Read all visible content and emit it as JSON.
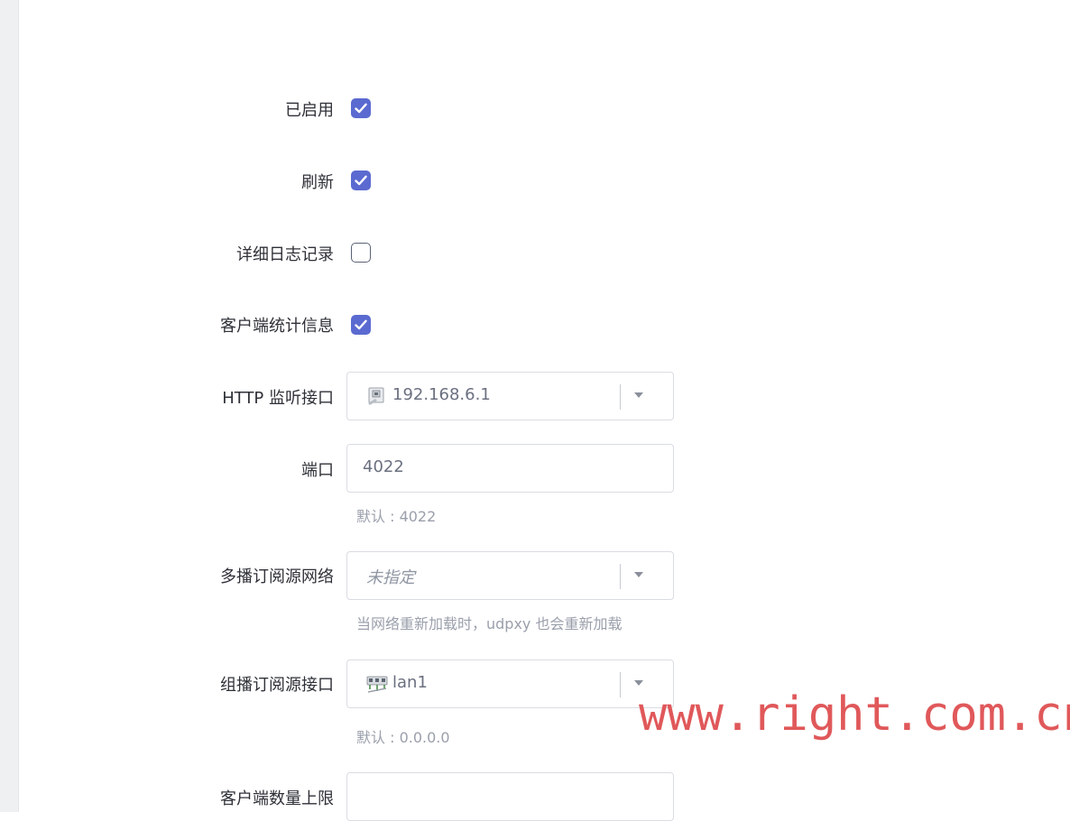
{
  "form": {
    "enabled": {
      "label": "已启用",
      "checked": true
    },
    "refresh": {
      "label": "刷新",
      "checked": true
    },
    "verbose_log": {
      "label": "详细日志记录",
      "checked": false
    },
    "client_stats": {
      "label": "客户端统计信息",
      "checked": true
    },
    "http_interface": {
      "label": "HTTP 监听接口",
      "value": "192.168.6.1",
      "icon": "network-port-icon"
    },
    "port": {
      "label": "端口",
      "value": "4022",
      "hint": "默认 : 4022"
    },
    "multicast_network": {
      "label": "多播订阅源网络",
      "placeholder": "未指定",
      "hint": "当网络重新加载时，udpxy 也会重新加载"
    },
    "multicast_interface": {
      "label": "组播订阅源接口",
      "value": "lan1",
      "hint": "默认 : 0.0.0.0",
      "icon": "bridge-port-icon"
    },
    "max_clients": {
      "label": "客户端数量上限",
      "value": ""
    }
  },
  "watermark": "www.right.com.cn",
  "colors": {
    "accent": "#5b6ad0",
    "watermark": "#e0585a"
  }
}
